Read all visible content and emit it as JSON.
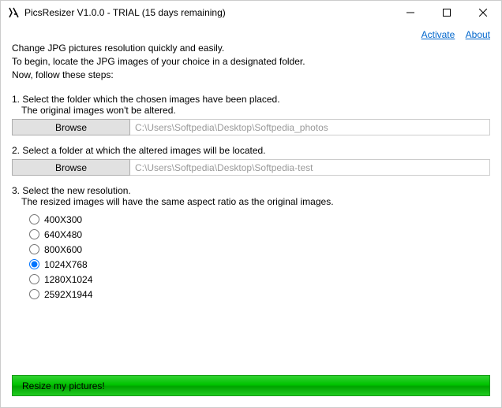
{
  "window": {
    "title": "PicsResizer V1.0.0 - TRIAL (15 days remaining)"
  },
  "links": {
    "activate": "Activate",
    "about": "About"
  },
  "intro": {
    "line1": "Change JPG pictures resolution quickly and easily.",
    "line2": "To begin, locate the JPG images of your choice in a designated folder.",
    "line3": "Now, follow these steps:"
  },
  "step1": {
    "head": "1. Select the folder which the chosen images have been placed.",
    "sub": "The original images won't be altered.",
    "browse": "Browse",
    "path": "C:\\Users\\Softpedia\\Desktop\\Softpedia_photos"
  },
  "step2": {
    "head": "2. Select a folder at which the altered images will be located.",
    "browse": "Browse",
    "path": "C:\\Users\\Softpedia\\Desktop\\Softpedia-test"
  },
  "step3": {
    "head": "3. Select the new resolution.",
    "sub": "The resized images will have the same aspect ratio as the original images."
  },
  "resolutions": {
    "r0": "400X300",
    "r1": "640X480",
    "r2": "800X600",
    "r3": "1024X768",
    "r4": "1280X1024",
    "r5": "2592X1944",
    "selected": "r3"
  },
  "action": {
    "resize": "Resize my pictures!"
  }
}
